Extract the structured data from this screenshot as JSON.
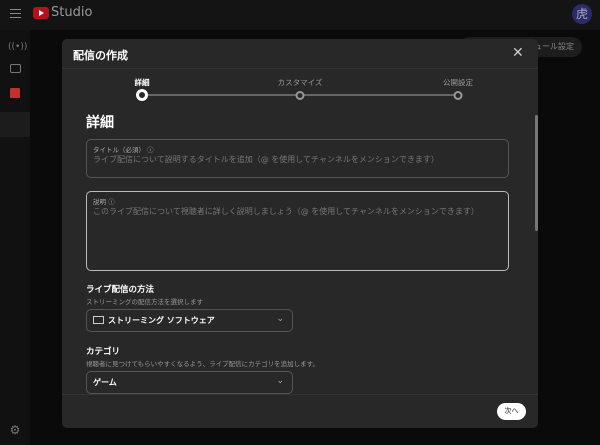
{
  "app": {
    "title": "Studio",
    "avatar_text": "虎",
    "bg_button": "ジュール設定"
  },
  "sidebar": {
    "icons": [
      "live-icon",
      "camera-icon",
      "calendar-icon",
      "gear-icon"
    ]
  },
  "modal": {
    "title": "配信の作成",
    "steps": [
      {
        "label": "詳細",
        "active": true
      },
      {
        "label": "カスタマイズ",
        "active": false
      },
      {
        "label": "公開設定",
        "active": false
      }
    ],
    "heading": "詳細",
    "title_field": {
      "label": "タイトル（必須）",
      "placeholder": "ライブ配信について説明するタイトルを追加（@ を使用してチャンネルをメンションできます）"
    },
    "description_field": {
      "label": "説明",
      "placeholder": "このライブ配信について視聴者に詳しく説明しましょう（@ を使用してチャンネルをメンションできます）"
    },
    "method": {
      "heading": "ライブ配信の方法",
      "sub": "ストリーミングの配信方法を選択します",
      "value": "ストリーミング ソフトウェア"
    },
    "category": {
      "heading": "カテゴリ",
      "sub": "視聴者に見つけてもらいやすくなるよう、ライブ配信にカテゴリを追加します。",
      "value": "ゲーム"
    },
    "next_label": "次へ"
  },
  "colors": {
    "accent": "#b5121b",
    "modal_bg": "#282828"
  }
}
